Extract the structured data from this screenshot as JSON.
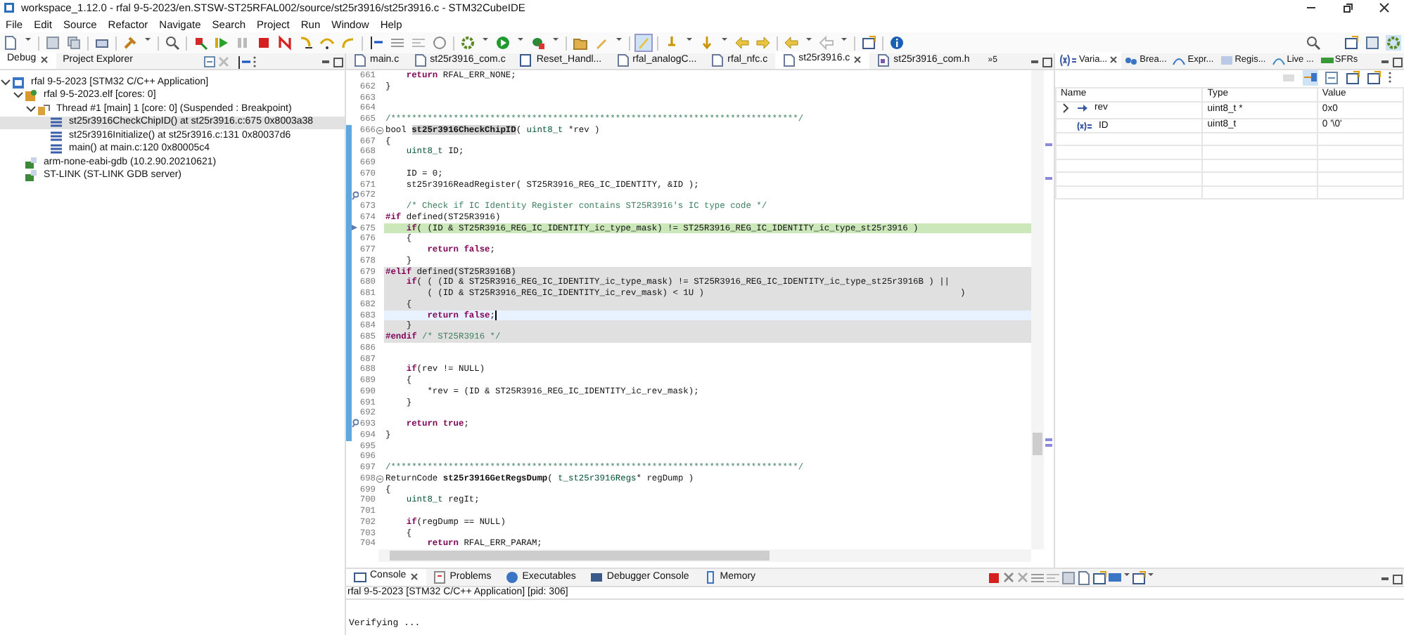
{
  "window": {
    "title": "workspace_1.12.0 - rfal 9-5-2023/en.STSW-ST25RFAL002/source/st25r3916/st25r3916.c - STM32CubeIDE"
  },
  "menu": [
    "File",
    "Edit",
    "Source",
    "Refactor",
    "Navigate",
    "Search",
    "Project",
    "Run",
    "Window",
    "Help"
  ],
  "debug_panel": {
    "tabs": [
      {
        "label": "Debug",
        "selected": true
      },
      {
        "label": "Project Explorer",
        "selected": false
      }
    ],
    "tree": [
      {
        "label": "rfal 9-5-2023 [STM32 C/C++ Application]",
        "kind": "launch",
        "expanded": true,
        "selected": false,
        "children": [
          {
            "label": "rfal 9-5-2023.elf [cores: 0]",
            "kind": "elf",
            "expanded": true,
            "selected": false,
            "children": [
              {
                "label": "Thread #1 [main] 1 [core: 0] (Suspended : Breakpoint)",
                "kind": "thread",
                "expanded": true,
                "selected": false,
                "children": [
                  {
                    "label": "st25r3916CheckChipID() at st25r3916.c:675 0x8003a38",
                    "kind": "frame",
                    "selected": true
                  },
                  {
                    "label": "st25r3916Initialize() at st25r3916.c:131 0x80037d6",
                    "kind": "frame",
                    "selected": false
                  },
                  {
                    "label": "main() at main.c:120 0x80005c4",
                    "kind": "frame",
                    "selected": false
                  }
                ]
              }
            ]
          },
          {
            "label": "arm-none-eabi-gdb (10.2.90.20210621)",
            "kind": "process",
            "selected": false
          },
          {
            "label": "ST-LINK (ST-LINK GDB server)",
            "kind": "process",
            "selected": false
          }
        ]
      }
    ]
  },
  "editor": {
    "tabs": [
      {
        "label": "main.c",
        "selected": false,
        "kind": "source"
      },
      {
        "label": "st25r3916_com.c",
        "selected": false,
        "kind": "source"
      },
      {
        "label": "Reset_Handl...",
        "selected": false,
        "kind": "disasm"
      },
      {
        "label": "rfal_analogC...",
        "selected": false,
        "kind": "source"
      },
      {
        "label": "rfal_nfc.c",
        "selected": false,
        "kind": "source"
      },
      {
        "label": "st25r3916.c",
        "selected": true,
        "kind": "source"
      },
      {
        "label": "st25r3916_com.h",
        "selected": false,
        "kind": "header"
      }
    ],
    "overflow": "»5",
    "lines": [
      {
        "num": "661",
        "parts": [
          {
            "kind": "kw",
            "text": "    return"
          },
          {
            "kind": "plain",
            "text": " RFAL_ERR_NONE;"
          }
        ]
      },
      {
        "num": "662",
        "parts": [
          {
            "kind": "plain",
            "text": "}"
          }
        ]
      },
      {
        "num": "663"
      },
      {
        "num": "664"
      },
      {
        "num": "665",
        "parts": [
          {
            "kind": "cm",
            "text": "/******************************************************************************/"
          }
        ]
      },
      {
        "num": "666",
        "fold": true,
        "in_range": true,
        "parts": [
          {
            "kind": "plain",
            "text": "bool "
          },
          {
            "kind": "fnmark",
            "text": "st25r3916CheckChipID"
          },
          {
            "kind": "plain",
            "text": "( "
          },
          {
            "kind": "type",
            "text": "uint8_t"
          },
          {
            "kind": "plain",
            "text": " *rev )"
          }
        ]
      },
      {
        "num": "667",
        "in_range": true,
        "parts": [
          {
            "kind": "plain",
            "text": "{"
          }
        ]
      },
      {
        "num": "668",
        "in_range": true,
        "parts": [
          {
            "kind": "type",
            "text": "    uint8_t"
          },
          {
            "kind": "plain",
            "text": " ID;"
          }
        ]
      },
      {
        "num": "669",
        "in_range": true
      },
      {
        "num": "670",
        "in_range": true,
        "parts": [
          {
            "kind": "plain",
            "text": "    ID = 0;"
          }
        ]
      },
      {
        "num": "671",
        "in_range": true,
        "parts": [
          {
            "kind": "plain",
            "text": "    st25r3916ReadRegister( ST25R3916_REG_IC_IDENTITY, &ID );"
          }
        ]
      },
      {
        "num": "672",
        "in_range": true,
        "annotation": true
      },
      {
        "num": "673",
        "in_range": true,
        "parts": [
          {
            "kind": "cm",
            "text": "    /* Check if IC Identity Register contains ST25R3916's IC type code */"
          }
        ]
      },
      {
        "num": "674",
        "in_range": true,
        "parts": [
          {
            "kind": "kw",
            "text": "#if"
          },
          {
            "kind": "plain",
            "text": " defined(ST25R3916)"
          }
        ]
      },
      {
        "num": "675",
        "in_range": true,
        "instruction_pointer": true,
        "current": true,
        "parts": [
          {
            "kind": "kw",
            "text": "    if"
          },
          {
            "kind": "plain",
            "text": "( (ID & ST25R3916_REG_IC_IDENTITY_ic_type_mask) != ST25R3916_REG_IC_IDENTITY_ic_type_st25r3916 )"
          }
        ]
      },
      {
        "num": "676",
        "in_range": true,
        "parts": [
          {
            "kind": "plain",
            "text": "    {"
          }
        ]
      },
      {
        "num": "677",
        "in_range": true,
        "parts": [
          {
            "kind": "kw",
            "text": "        return false"
          },
          {
            "kind": "plain",
            "text": ";"
          }
        ]
      },
      {
        "num": "678",
        "in_range": true,
        "parts": [
          {
            "kind": "plain",
            "text": "    }"
          }
        ]
      },
      {
        "num": "679",
        "in_range": true,
        "inactive": true,
        "parts": [
          {
            "kind": "kw",
            "text": "#elif"
          },
          {
            "kind": "plain",
            "text": " defined(ST25R3916B)"
          }
        ]
      },
      {
        "num": "680",
        "in_range": true,
        "inactive": true,
        "parts": [
          {
            "kind": "kw",
            "text": "    if"
          },
          {
            "kind": "plain",
            "text": "( ( (ID & ST25R3916_REG_IC_IDENTITY_ic_type_mask) != ST25R3916_REG_IC_IDENTITY_ic_type_st25r3916B ) ||"
          }
        ]
      },
      {
        "num": "681",
        "in_range": true,
        "inactive": true,
        "parts": [
          {
            "kind": "plain",
            "text": "        ( (ID & ST25R3916_REG_IC_IDENTITY_ic_rev_mask) < 1U )                                                 )"
          }
        ]
      },
      {
        "num": "682",
        "in_range": true,
        "inactive": true,
        "parts": [
          {
            "kind": "plain",
            "text": "    {"
          }
        ]
      },
      {
        "num": "683",
        "in_range": true,
        "cursor": true,
        "parts": [
          {
            "kind": "kw",
            "text": "        return false"
          },
          {
            "kind": "plain",
            "text": ";"
          }
        ]
      },
      {
        "num": "684",
        "in_range": true,
        "inactive": true,
        "parts": [
          {
            "kind": "plain",
            "text": "    }"
          }
        ]
      },
      {
        "num": "685",
        "in_range": true,
        "inactive": true,
        "parts": [
          {
            "kind": "kw",
            "text": "#endif"
          },
          {
            "kind": "cm",
            "text": " /* ST25R3916 */"
          }
        ]
      },
      {
        "num": "686",
        "in_range": true
      },
      {
        "num": "687",
        "in_range": true
      },
      {
        "num": "688",
        "in_range": true,
        "parts": [
          {
            "kind": "kw",
            "text": "    if"
          },
          {
            "kind": "plain",
            "text": "(rev != NULL)"
          }
        ]
      },
      {
        "num": "689",
        "in_range": true,
        "parts": [
          {
            "kind": "plain",
            "text": "    {"
          }
        ]
      },
      {
        "num": "690",
        "in_range": true,
        "parts": [
          {
            "kind": "plain",
            "text": "        *rev = (ID & ST25R3916_REG_IC_IDENTITY_ic_rev_mask);"
          }
        ]
      },
      {
        "num": "691",
        "in_range": true,
        "parts": [
          {
            "kind": "plain",
            "text": "    }"
          }
        ]
      },
      {
        "num": "692",
        "in_range": true
      },
      {
        "num": "693",
        "in_range": true,
        "annotation": true,
        "parts": [
          {
            "kind": "kw",
            "text": "    return true"
          },
          {
            "kind": "plain",
            "text": ";"
          }
        ]
      },
      {
        "num": "694",
        "in_range": true,
        "parts": [
          {
            "kind": "plain",
            "text": "}"
          }
        ]
      },
      {
        "num": "695"
      },
      {
        "num": "696"
      },
      {
        "num": "697",
        "parts": [
          {
            "kind": "cm",
            "text": "/******************************************************************************/"
          }
        ]
      },
      {
        "num": "698",
        "fold": true,
        "parts": [
          {
            "kind": "plain",
            "text": "ReturnCode "
          },
          {
            "kind": "fn",
            "text": "st25r3916GetRegsDump"
          },
          {
            "kind": "plain",
            "text": "( "
          },
          {
            "kind": "type",
            "text": "t_st25r3916Regs"
          },
          {
            "kind": "plain",
            "text": "* regDump )"
          }
        ]
      },
      {
        "num": "699",
        "parts": [
          {
            "kind": "plain",
            "text": "{"
          }
        ]
      },
      {
        "num": "700",
        "parts": [
          {
            "kind": "type",
            "text": "    uint8_t"
          },
          {
            "kind": "plain",
            "text": " regIt;"
          }
        ]
      },
      {
        "num": "701"
      },
      {
        "num": "702",
        "parts": [
          {
            "kind": "kw",
            "text": "    if"
          },
          {
            "kind": "plain",
            "text": "(regDump == NULL)"
          }
        ]
      },
      {
        "num": "703",
        "parts": [
          {
            "kind": "plain",
            "text": "    {"
          }
        ]
      },
      {
        "num": "704",
        "parts": [
          {
            "kind": "kw",
            "text": "        return"
          },
          {
            "kind": "plain",
            "text": " RFAL_ERR_PARAM;"
          }
        ]
      }
    ]
  },
  "variables_panel": {
    "tabs": [
      {
        "label": "Varia...",
        "selected": true,
        "kind": "variables"
      },
      {
        "label": "Brea...",
        "selected": false,
        "kind": "breakpoints"
      },
      {
        "label": "Expr...",
        "selected": false,
        "kind": "expressions"
      },
      {
        "label": "Regis...",
        "selected": false,
        "kind": "registers"
      },
      {
        "label": "Live ...",
        "selected": false,
        "kind": "live"
      },
      {
        "label": "SFRs",
        "selected": false,
        "kind": "sfrs"
      }
    ],
    "columns": [
      "Name",
      "Type",
      "Value"
    ],
    "rows": [
      {
        "name": "rev",
        "type": "uint8_t *",
        "value": "0x0",
        "kind": "pointer",
        "expanded": false
      },
      {
        "name": "ID",
        "type": "uint8_t",
        "value": "0 '\\0'",
        "kind": "local"
      }
    ]
  },
  "console": {
    "tabs": [
      {
        "label": "Console",
        "selected": true,
        "kind": "console"
      },
      {
        "label": "Problems",
        "selected": false,
        "kind": "problems"
      },
      {
        "label": "Executables",
        "selected": false,
        "kind": "executables"
      },
      {
        "label": "Debugger Console",
        "selected": false,
        "kind": "debugger"
      },
      {
        "label": "Memory",
        "selected": false,
        "kind": "memory"
      }
    ],
    "header": "rfal 9-5-2023 [STM32 C/C++ Application]  [pid: 306]",
    "output": "Verifying ..."
  }
}
